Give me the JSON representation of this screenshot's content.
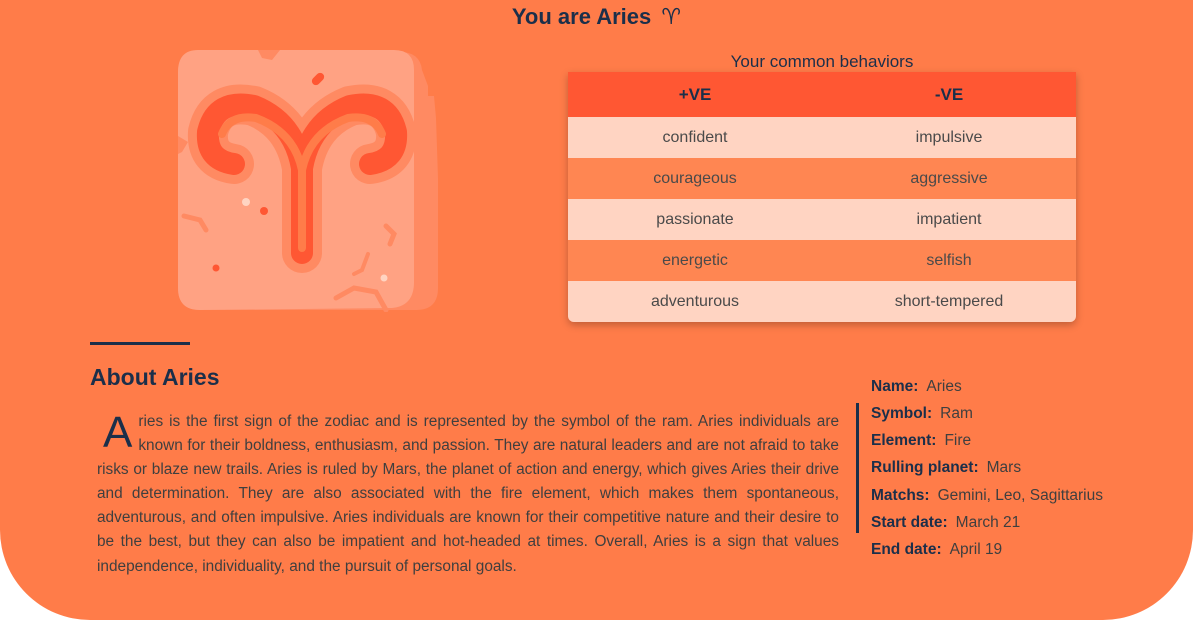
{
  "header": {
    "title": "You are Aries",
    "symbol": "♈"
  },
  "emblem": {
    "icon": "aries-ram-horns-icon",
    "colors": {
      "tile": "#ffa283",
      "tile_shadow": "#ff8a62",
      "horn_outline": "#ff8a62",
      "horn_fill": "#ff5733",
      "horn_inner": "#ff7c49",
      "speck_light": "#ffd4c2",
      "speck_dark": "#ff5733"
    }
  },
  "behaviors": {
    "caption": "Your common behaviors",
    "headers": {
      "positive": "+VE",
      "negative": "-VE"
    },
    "rows": [
      {
        "positive": "confident",
        "negative": "impulsive"
      },
      {
        "positive": "courageous",
        "negative": "aggressive"
      },
      {
        "positive": "passionate",
        "negative": "impatient"
      },
      {
        "positive": "energetic",
        "negative": "selfish"
      },
      {
        "positive": "adventurous",
        "negative": "short-tempered"
      }
    ]
  },
  "about": {
    "heading": "About Aries",
    "dropcap": "A",
    "text": "ries is the first sign of the zodiac and is represented by the symbol of the ram. Aries individuals are known for their boldness, enthusiasm, and passion. They are natural leaders and are not afraid to take risks or blaze new trails. Aries is ruled by Mars, the planet of action and energy, which gives Aries their drive and determination. They are also associated with the fire element, which makes them spontaneous, adventurous, and often impulsive. Aries individuals are known for their competitive nature and their desire to be the best, but they can also be impatient and hot-headed at times. Overall, Aries is a sign that values independence, individuality, and the pursuit of personal goals."
  },
  "facts": {
    "name": {
      "label": "Name:",
      "value": "Aries"
    },
    "symbol": {
      "label": "Symbol:",
      "value": "Ram"
    },
    "element": {
      "label": "Element:",
      "value": "Fire"
    },
    "ruling_planet": {
      "label": "Rulling planet:",
      "value": "Mars"
    },
    "matches": {
      "label": "Matchs:",
      "value": "Gemini, Leo, Sagittarius"
    },
    "start_date": {
      "label": "Start date:",
      "value": "March 21"
    },
    "end_date": {
      "label": "End date:",
      "value": "April 19"
    }
  },
  "colors": {
    "background": "#ff7c49",
    "accent": "#ff5733",
    "text_dark": "#1b2f4a",
    "row_light": "#ffd4c2",
    "row_dark": "#ff8652"
  }
}
